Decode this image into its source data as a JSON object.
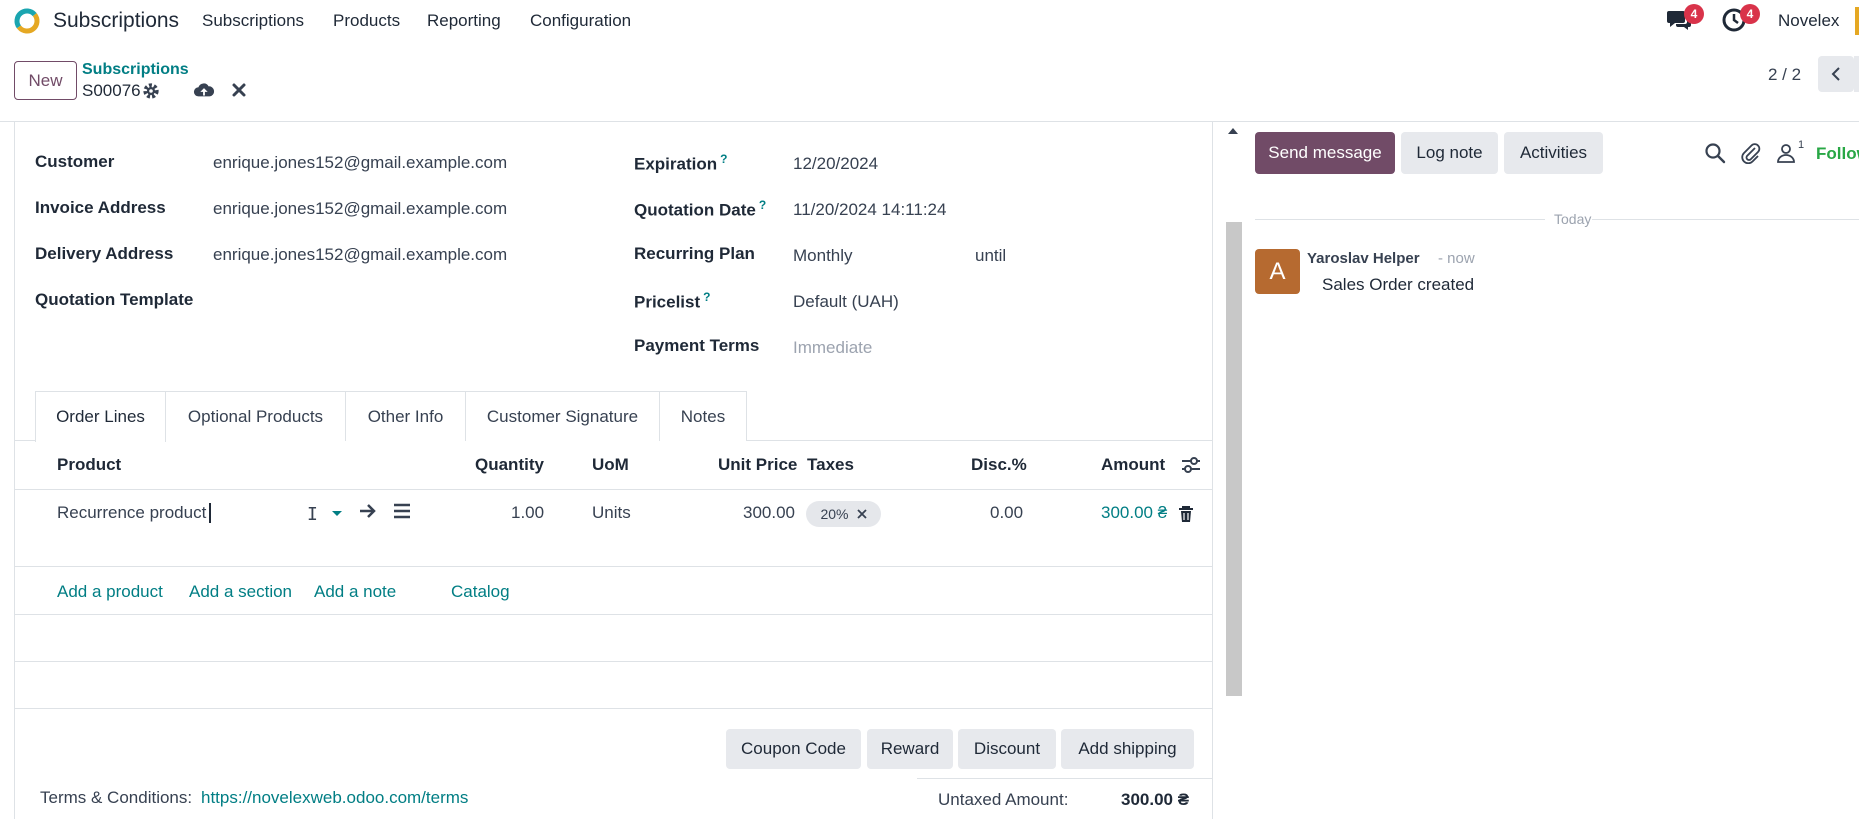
{
  "navbar": {
    "app_name": "Subscriptions",
    "menu": [
      "Subscriptions",
      "Products",
      "Reporting",
      "Configuration"
    ],
    "messages_badge": "4",
    "activities_badge": "4",
    "company": "Novelex"
  },
  "control_panel": {
    "new_label": "New",
    "breadcrumb_parent": "Subscriptions",
    "record_name": "S00076",
    "pager": "2 / 2"
  },
  "form": {
    "customer": {
      "label": "Customer",
      "value": "enrique.jones152@gmail.example.com"
    },
    "invoice_address": {
      "label": "Invoice Address",
      "value": "enrique.jones152@gmail.example.com"
    },
    "delivery_address": {
      "label": "Delivery Address",
      "value": "enrique.jones152@gmail.example.com"
    },
    "quotation_template": {
      "label": "Quotation Template",
      "value": ""
    },
    "expiration": {
      "label": "Expiration",
      "help": "?",
      "value": "12/20/2024"
    },
    "quotation_date": {
      "label": "Quotation Date",
      "help": "?",
      "value": "11/20/2024 14:11:24"
    },
    "recurring_plan": {
      "label": "Recurring Plan",
      "value": "Monthly",
      "until": "until"
    },
    "pricelist": {
      "label": "Pricelist",
      "help": "?",
      "value": "Default (UAH)"
    },
    "payment_terms": {
      "label": "Payment Terms",
      "placeholder": "Immediate"
    }
  },
  "tabs": [
    "Order Lines",
    "Optional Products",
    "Other Info",
    "Customer Signature",
    "Notes"
  ],
  "order_lines": {
    "columns": {
      "product": "Product",
      "quantity": "Quantity",
      "uom": "UoM",
      "unit_price": "Unit Price",
      "taxes": "Taxes",
      "discount": "Disc.%",
      "amount": "Amount"
    },
    "rows": [
      {
        "product": "Recurrence product",
        "quantity": "1.00",
        "uom": "Units",
        "unit_price": "300.00",
        "tax": "20%",
        "discount": "0.00",
        "amount": "300.00 ₴"
      }
    ],
    "add_links": [
      "Add a product",
      "Add a section",
      "Add a note",
      "Catalog"
    ]
  },
  "actions": [
    "Coupon Code",
    "Reward",
    "Discount",
    "Add shipping"
  ],
  "footer": {
    "terms_label": "Terms & Conditions:",
    "terms_link": "https://novelexweb.odoo.com/terms",
    "untaxed_label": "Untaxed Amount:",
    "untaxed_value": "300.00 ₴"
  },
  "chatter": {
    "send_message": "Send message",
    "log_note": "Log note",
    "activities": "Activities",
    "followers_count": "1",
    "follow": "Follow",
    "date_separator": "Today",
    "message": {
      "avatar_letter": "A",
      "author": "Yaroslav Helper",
      "time": "- now",
      "body": "Sales Order created"
    }
  },
  "colors": {
    "brand": "#714B67",
    "link": "#017e84",
    "badge": "#d9334a",
    "avatar": "#b66a30"
  }
}
